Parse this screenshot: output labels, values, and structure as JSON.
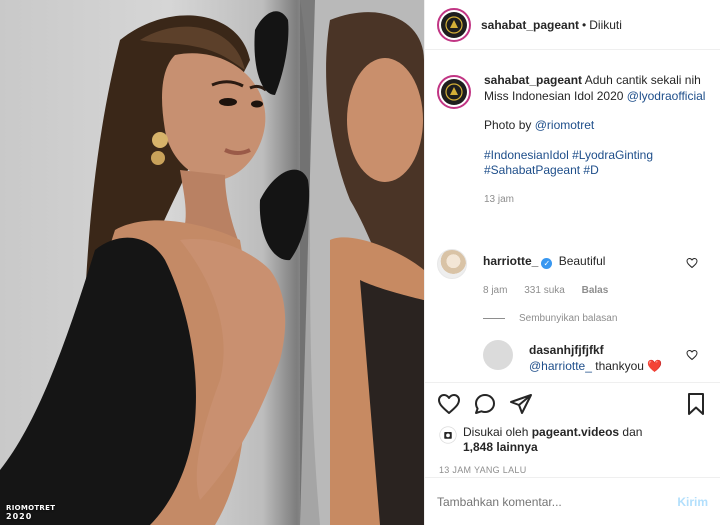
{
  "photo": {
    "watermark_line1": "RIOMOTRET",
    "watermark_line2": "2020"
  },
  "post": {
    "username": "sahabat_pageant",
    "separator": "•",
    "follow_status": "Diikuti"
  },
  "caption": {
    "username": "sahabat_pageant",
    "text": "Aduh cantik sekali nih Miss Indonesian Idol 2020",
    "mention": "@lyodraofficial",
    "credit_prefix": "Photo by",
    "credit_mention": "@riomotret",
    "hashtags_line1": "#IndonesianIdol #LyodraGinting",
    "hashtags_line2": "#SahabatPageant #D",
    "time": "13 jam"
  },
  "comments": [
    {
      "username": "harriotte_",
      "text": "Beautiful",
      "time": "8 jam",
      "likes": "331 suka",
      "reply_label": "Balas"
    }
  ],
  "hide_replies": "Sembunyikan balasan",
  "reply": {
    "username": "dasanhjfjfjfkf",
    "mention": "@harriotte_",
    "text": "thankyou",
    "emoji": "❤️"
  },
  "likes_line": {
    "prefix": "Disukai oleh",
    "user": "pageant.videos",
    "conj": "dan",
    "others": "1,848 lainnya"
  },
  "date": "13 JAM YANG LALU",
  "comment_box": {
    "placeholder": "Tambahkan komentar...",
    "post_label": "Kirim"
  },
  "colors": {
    "link": "#1e4e8a",
    "muted": "#8e8e8e",
    "post_disabled": "#b2dffc",
    "heart": "#ed4956",
    "story_ring": "#c13584",
    "verified": "#3897f0"
  },
  "icons": [
    "heart-icon",
    "comment-icon",
    "share-icon",
    "bookmark-icon",
    "verified-icon"
  ]
}
